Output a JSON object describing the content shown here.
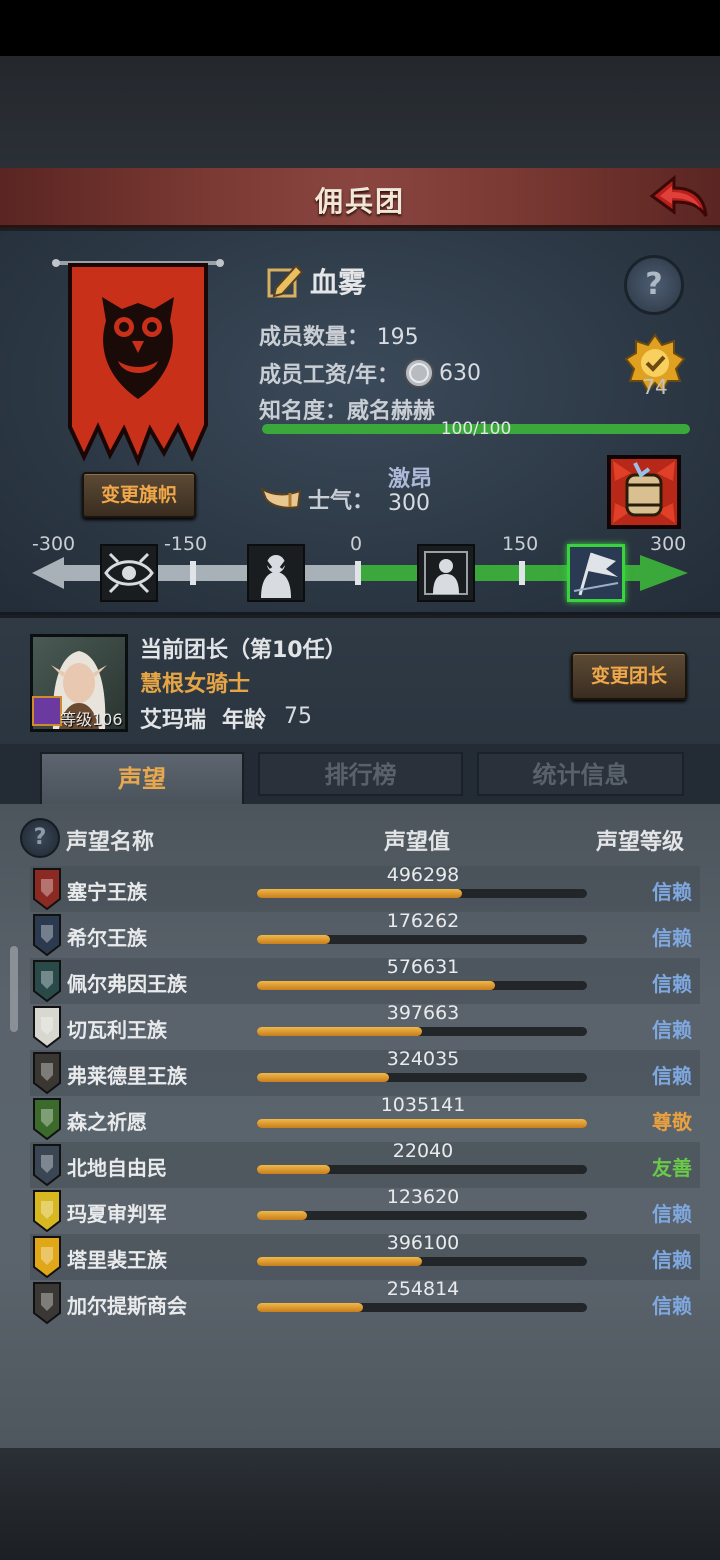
{
  "header": {
    "title": "佣兵团"
  },
  "guild": {
    "name": "血雾",
    "change_flag_label": "变更旗帜",
    "members_label": "成员数量：",
    "members_value": "195",
    "salary_label": "成员工资/年：",
    "salary_value": "630",
    "fame_label": "知名度：",
    "fame_state": "威名赫赫",
    "fame_progress_text": "100/100",
    "fame_progress_fraction": 1.0,
    "rank_badge_value": "74",
    "morale_label": "士气：",
    "morale_state": "激昂",
    "morale_value": "300"
  },
  "morale_scale": {
    "ticks": [
      "-300",
      "-150",
      "0",
      "150",
      "300"
    ],
    "stage_icons": [
      "frenzy-eye-icon",
      "despair-figure-icon",
      "calm-figure-icon",
      "victory-banner-icon"
    ],
    "active_stage": 3
  },
  "leader": {
    "title": "当前团长（第10任）",
    "class": "慧根女骑士",
    "name": "艾玛瑞",
    "age_label": "年龄",
    "age": "75",
    "level_text": "等级106",
    "change_leader_label": "变更团长"
  },
  "tabs": [
    {
      "label": "声望",
      "active": true
    },
    {
      "label": "排行榜",
      "active": false
    },
    {
      "label": "统计信息",
      "active": false
    }
  ],
  "reputation": {
    "headers": {
      "name": "声望名称",
      "value": "声望值",
      "level": "声望等级"
    },
    "rows": [
      {
        "name": "塞宁王族",
        "value": "496298",
        "fill": 0.62,
        "level": "信赖",
        "level_color": "#7fa8e0",
        "icon_color": "#8a2a22"
      },
      {
        "name": "希尔王族",
        "value": "176262",
        "fill": 0.22,
        "level": "信赖",
        "level_color": "#7fa8e0",
        "icon_color": "#2c3a50"
      },
      {
        "name": "佩尔弗因王族",
        "value": "576631",
        "fill": 0.72,
        "level": "信赖",
        "level_color": "#7fa8e0",
        "icon_color": "#2a4a4a"
      },
      {
        "name": "切瓦利王族",
        "value": "397663",
        "fill": 0.5,
        "level": "信赖",
        "level_color": "#7fa8e0",
        "icon_color": "#d8d8d0"
      },
      {
        "name": "弗莱德里王族",
        "value": "324035",
        "fill": 0.4,
        "level": "信赖",
        "level_color": "#7fa8e0",
        "icon_color": "#3a3632"
      },
      {
        "name": "森之祈愿",
        "value": "1035141",
        "fill": 1.0,
        "level": "尊敬",
        "level_color": "#e8a040",
        "icon_color": "#3c6a2c"
      },
      {
        "name": "北地自由民",
        "value": "22040",
        "fill": 0.22,
        "level": "友善",
        "level_color": "#6ac84a",
        "icon_color": "#3a4654"
      },
      {
        "name": "玛夏审判军",
        "value": "123620",
        "fill": 0.15,
        "level": "信赖",
        "level_color": "#7fa8e0",
        "icon_color": "#d8b820"
      },
      {
        "name": "塔里裴王族",
        "value": "396100",
        "fill": 0.5,
        "level": "信赖",
        "level_color": "#7fa8e0",
        "icon_color": "#e0a818"
      },
      {
        "name": "加尔提斯商会",
        "value": "254814",
        "fill": 0.32,
        "level": "信赖",
        "level_color": "#7fa8e0",
        "icon_color": "#3a3834"
      }
    ]
  }
}
